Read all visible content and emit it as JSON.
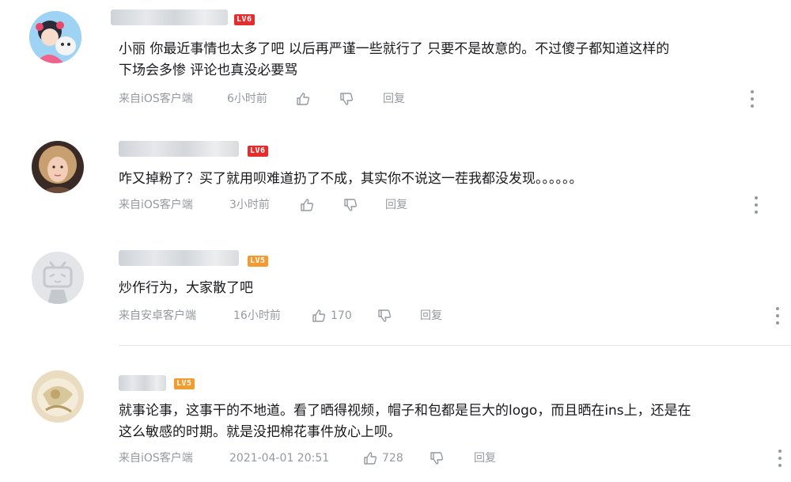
{
  "comments": [
    {
      "level": "LV6",
      "level_color": "#e52d2d",
      "lines": [
        "小丽 你最近事情也太多了吧 以后再严谨一些就行了 只要不是故意的。不过傻子都知道这样的",
        "下场会多惨 评论也真没必要骂"
      ],
      "source": "来自iOS客户端",
      "time": "6小时前",
      "likes": "",
      "reply": "回复"
    },
    {
      "level": "LV6",
      "level_color": "#e52d2d",
      "lines": [
        "咋又掉粉了？买了就用呗难道扔了不成，其实你不说这一茬我都没发现。。。。。。"
      ],
      "source": "来自iOS客户端",
      "time": "3小时前",
      "likes": "",
      "reply": "回复"
    },
    {
      "level": "LV5",
      "level_color": "#f39b2f",
      "lines": [
        "炒作行为，大家散了吧"
      ],
      "source": "来自安卓客户端",
      "time": "16小时前",
      "likes": "170",
      "reply": "回复"
    },
    {
      "level": "LV5",
      "level_color": "#f39b2f",
      "lines": [
        "就事论事，这事干的不地道。看了晒得视频，帽子和包都是巨大的logo，而且晒在ins上，还是在",
        "这么敏感的时期。就是没把棉花事件放心上呗。"
      ],
      "source": "来自iOS客户端",
      "time": "2021-04-01 20:51",
      "likes": "728",
      "reply": "回复"
    }
  ]
}
